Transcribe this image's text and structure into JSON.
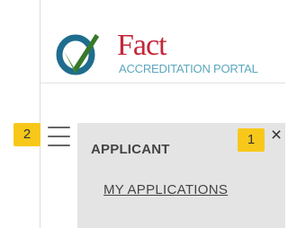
{
  "header": {
    "brand_name": "Fact",
    "brand_subtitle": "ACCREDITATION PORTAL",
    "logo_colors": {
      "ring": "#1f6d8e",
      "check": "#4f9a3c",
      "check_dark": "#37782a"
    }
  },
  "nav": {
    "hamburger_icon": "hamburger-menu-icon",
    "close_icon": "close-icon",
    "close_glyph": "×",
    "section_title": "APPLICANT",
    "items": [
      {
        "label": "MY APPLICATIONS"
      }
    ]
  },
  "badges": [
    {
      "label": "2",
      "color": "#f7c81a"
    },
    {
      "label": "1",
      "color": "#f7c81a"
    }
  ]
}
